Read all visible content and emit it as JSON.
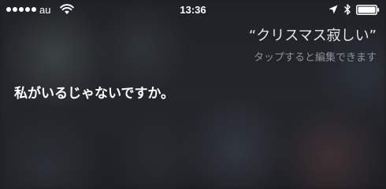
{
  "status_bar": {
    "signal_dots": 5,
    "carrier": "au",
    "time": "13:36",
    "icons": [
      "wifi-icon",
      "location-arrow-icon",
      "bluetooth-icon",
      "battery-icon"
    ]
  },
  "siri": {
    "query": "“クリスマス寂しい”",
    "edit_hint": "タップすると編集できます",
    "response": "私がいるじゃないですか。"
  },
  "colors": {
    "background": "#1c1e22",
    "text_primary": "#ffffff",
    "text_hint": "#8e9299"
  }
}
